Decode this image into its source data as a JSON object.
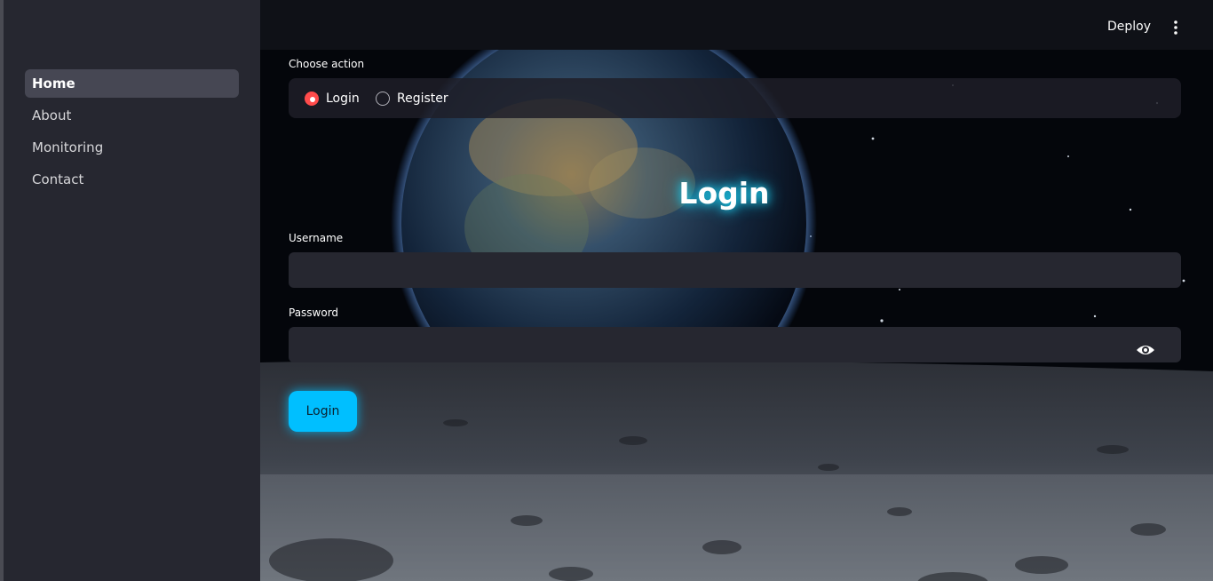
{
  "sidebar": {
    "items": [
      {
        "label": "Home",
        "active": true
      },
      {
        "label": "About",
        "active": false
      },
      {
        "label": "Monitoring",
        "active": false
      },
      {
        "label": "Contact",
        "active": false
      }
    ]
  },
  "header": {
    "deploy_label": "Deploy",
    "menu_icon": "vertical-dots-icon"
  },
  "form": {
    "choose_action_label": "Choose action",
    "options": [
      {
        "label": "Login",
        "selected": true
      },
      {
        "label": "Register",
        "selected": false
      }
    ],
    "title": "Login",
    "username_label": "Username",
    "username_value": "",
    "password_label": "Password",
    "password_value": "",
    "password_icon": "eye-icon",
    "submit_label": "Login"
  },
  "colors": {
    "accent": "#00bfff",
    "radio_selected": "#ff4b4b",
    "title_glow": "#19c7e8",
    "sidebar_bg": "#262730"
  }
}
